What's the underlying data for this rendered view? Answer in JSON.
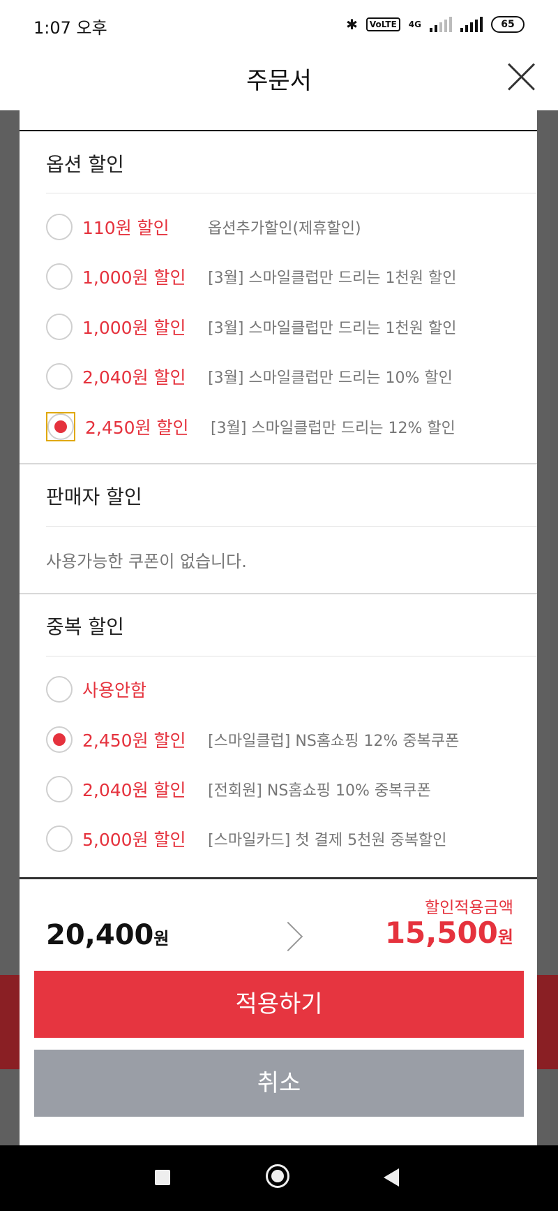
{
  "status_bar": {
    "time": "1:07 오후",
    "network": "4G",
    "volte": "VoLTE",
    "battery": "65"
  },
  "header": {
    "title": "주문서"
  },
  "option_discount": {
    "title": "옵션 할인",
    "items": [
      {
        "amount": "110원 할인",
        "desc": "옵션추가할인(제휴할인)",
        "selected": false
      },
      {
        "amount": "1,000원 할인",
        "desc": "[3월] 스마일클럽만 드리는 1천원 할인",
        "selected": false
      },
      {
        "amount": "1,000원 할인",
        "desc": "[3월] 스마일클럽만 드리는 1천원 할인",
        "selected": false
      },
      {
        "amount": "2,040원 할인",
        "desc": "[3월] 스마일클럽만 드리는 10% 할인",
        "selected": false
      },
      {
        "amount": "2,450원 할인",
        "desc": "[3월] 스마일클럽만 드리는 12% 할인",
        "selected": true
      }
    ]
  },
  "seller_discount": {
    "title": "판매자 할인",
    "empty_text": "사용가능한 쿠폰이 없습니다."
  },
  "duplicate_discount": {
    "title": "중복 할인",
    "items": [
      {
        "amount": "사용안함",
        "desc": "",
        "selected": false
      },
      {
        "amount": "2,450원 할인",
        "desc": "[스마일클럽] NS홈쇼핑 12% 중복쿠폰",
        "selected": true
      },
      {
        "amount": "2,040원 할인",
        "desc": "[전회원] NS홈쇼핑 10% 중복쿠폰",
        "selected": false
      },
      {
        "amount": "5,000원 할인",
        "desc": "[스마일카드] 첫 결제 5천원 중복할인",
        "selected": false
      }
    ]
  },
  "summary": {
    "original_price": "20,400",
    "discounted_label": "할인적용금액",
    "discounted_price": "15,500",
    "currency_unit": "원"
  },
  "buttons": {
    "apply": "적용하기",
    "cancel": "취소"
  },
  "colors": {
    "accent": "#e63540",
    "cancel_gray": "#9a9ea6"
  }
}
